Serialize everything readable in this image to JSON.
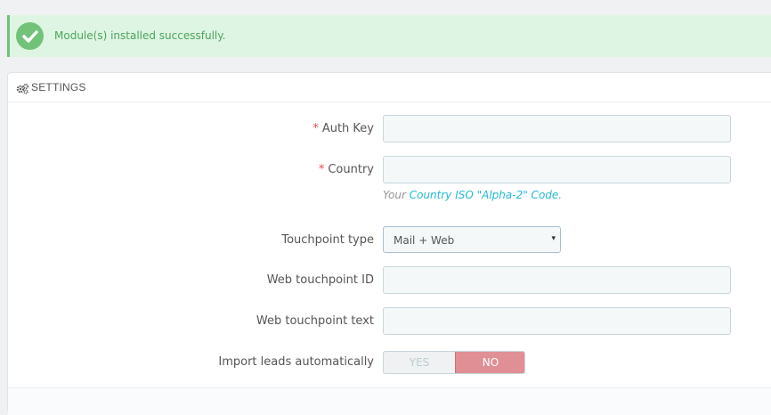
{
  "alert": {
    "icon": "check-circle-icon",
    "message": "Module(s) installed successfully."
  },
  "panel": {
    "icon": "gears-icon",
    "title": "SETTINGS"
  },
  "form": {
    "auth_key": {
      "label": "Auth Key",
      "required_mark": "*",
      "value": ""
    },
    "country": {
      "label": "Country",
      "required_mark": "*",
      "value": ""
    },
    "country_help": {
      "prefix": "Your ",
      "link": "Country ISO \"Alpha-2\" Code",
      "suffix": "."
    },
    "touchpoint_type": {
      "label": "Touchpoint type",
      "selected": "Mail + Web",
      "caret": "▾"
    },
    "web_touchpoint_id": {
      "label": "Web touchpoint ID",
      "value": ""
    },
    "web_touchpoint_text": {
      "label": "Web touchpoint text",
      "value": ""
    },
    "import_leads": {
      "label": "Import leads automatically",
      "yes": "YES",
      "no": "NO",
      "selected": "NO"
    }
  },
  "colors": {
    "success": "#72c279",
    "required": "#e24c4c",
    "link": "#25b9d7",
    "switch_no": "#e08f95"
  }
}
